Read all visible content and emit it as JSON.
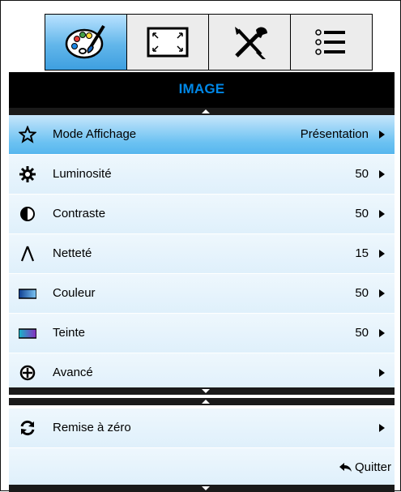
{
  "tabs": [
    {
      "icon": "palette-icon"
    },
    {
      "icon": "screen-resize-icon"
    },
    {
      "icon": "tools-icon"
    },
    {
      "icon": "list-options-icon"
    }
  ],
  "header": {
    "title": "IMAGE"
  },
  "menu": {
    "items": [
      {
        "label": "Mode Affichage",
        "value": "Présentation",
        "icon": "star-icon",
        "selected": true
      },
      {
        "label": "Luminosité",
        "value": "50",
        "icon": "brightness-icon"
      },
      {
        "label": "Contraste",
        "value": "50",
        "icon": "contrast-icon"
      },
      {
        "label": "Netteté",
        "value": "15",
        "icon": "sharpness-icon"
      },
      {
        "label": "Couleur",
        "value": "50",
        "icon": "color-icon"
      },
      {
        "label": "Teinte",
        "value": "50",
        "icon": "tint-icon"
      },
      {
        "label": "Avancé",
        "value": "",
        "icon": "advanced-plus-icon"
      }
    ]
  },
  "reset": {
    "label": "Remise à zéro",
    "icon": "reset-icon"
  },
  "footer": {
    "quit_label": "Quitter",
    "icon": "back-arrow-icon"
  },
  "colors": {
    "selected": "#5ab8ee",
    "row": "#e6f3fc",
    "title": "#0088e8"
  }
}
